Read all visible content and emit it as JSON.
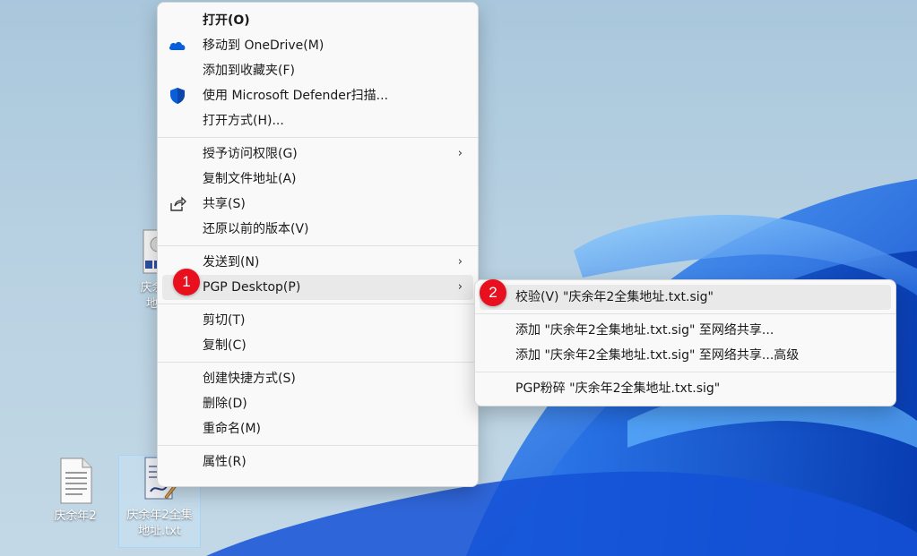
{
  "context_menu": {
    "items": [
      {
        "label": "打开(O)"
      },
      {
        "label": "移动到 OneDrive(M)",
        "icon": "onedrive-icon"
      },
      {
        "label": "添加到收藏夹(F)"
      },
      {
        "label": "使用 Microsoft Defender扫描...",
        "icon": "defender-shield-icon"
      },
      {
        "label": "打开方式(H)..."
      },
      {
        "label": "授予访问权限(G)",
        "arrow": "›"
      },
      {
        "label": "复制文件地址(A)"
      },
      {
        "label": "共享(S)",
        "icon": "share-icon"
      },
      {
        "label": "还原以前的版本(V)"
      },
      {
        "label": "发送到(N)",
        "arrow": "›"
      },
      {
        "label": "PGP Desktop(P)",
        "arrow": "›"
      },
      {
        "label": "剪切(T)"
      },
      {
        "label": "复制(C)"
      },
      {
        "label": "创建快捷方式(S)"
      },
      {
        "label": "删除(D)"
      },
      {
        "label": "重命名(M)"
      },
      {
        "label": "属性(R)"
      }
    ]
  },
  "submenu": {
    "items": [
      {
        "label": "校验(V) \"庆余年2全集地址.txt.sig\""
      },
      {
        "label": "添加 \"庆余年2全集地址.txt.sig\" 至网络共享..."
      },
      {
        "label": "添加 \"庆余年2全集地址.txt.sig\" 至网络共享...高级"
      },
      {
        "label": "PGP粉碎 \"庆余年2全集地址.txt.sig\""
      }
    ]
  },
  "badges": {
    "one": "1",
    "two": "2"
  },
  "desktop_icons": [
    {
      "label_line1": "庆余年",
      "label_line2": "地址"
    },
    {
      "label_line1": "庆余年2",
      "label_line2": ""
    },
    {
      "label_line1": "庆余年2全集",
      "label_line2": "地址.txt"
    }
  ],
  "colors": {
    "badge": "#e8101e",
    "accent": "#0a5fd8",
    "menu_bg": "#f9f9f9"
  }
}
